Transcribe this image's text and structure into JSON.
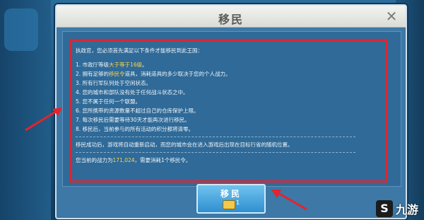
{
  "dialog": {
    "title": "移民",
    "close_label": "✕",
    "intro": "执政官，您必须首先满足以下条件才能移民到此王国：",
    "conditions": [
      {
        "prefix": "1. 市政厅等级",
        "highlight": "大于等于16级",
        "suffix": "。"
      },
      {
        "prefix": "2. 拥有足够的",
        "highlight": "移民令",
        "suffix": "道具，消耗道具的多少取决于您的个人战力。"
      },
      {
        "prefix": "3. 所有行军队列处于空闲状态。",
        "highlight": "",
        "suffix": ""
      },
      {
        "prefix": "4. 您的城市和部队没有处于任何战斗状态之中。",
        "highlight": "",
        "suffix": ""
      },
      {
        "prefix": "5. 您不属于任何一个联盟。",
        "highlight": "",
        "suffix": ""
      },
      {
        "prefix": "6. 您所携带的资源数量不超过自己的仓库保护上限。",
        "highlight": "",
        "suffix": ""
      },
      {
        "prefix": "7. 每次移民后需要等待30天才能再次进行移民。",
        "highlight": "",
        "suffix": ""
      },
      {
        "prefix": "8. 移民后，当前参与的所有活动的积分都将清零。",
        "highlight": "",
        "suffix": ""
      }
    ],
    "success_note": "移民成功后，游戏将自动重新启动，而您的城市会在进入游戏后出现在目标行省的随机位置。",
    "power_prefix": "您当前的战力为",
    "power_value": "171,024",
    "power_suffix": "，需要消耗1个移民令。",
    "button_label": "移民",
    "button_cost": "1"
  },
  "watermark": {
    "logo": "S",
    "text": "九游"
  },
  "colors": {
    "highlight_border": "#e3232d",
    "arrow": "#e3232d",
    "accent_yellow": "#ffd54a"
  },
  "icons": {
    "close": "close-icon",
    "token": "migration-token-icon",
    "arrow": "red-arrow-icon"
  }
}
